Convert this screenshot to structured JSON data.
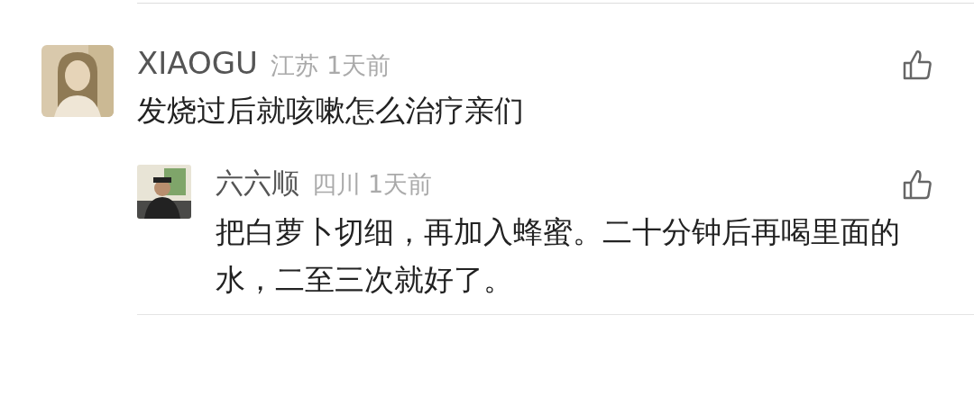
{
  "comments": [
    {
      "name": "XIAOGU",
      "location": "江苏",
      "time": "1天前",
      "text": "发烧过后就咳嗽怎么治疗亲们",
      "replies": [
        {
          "name": "六六顺",
          "location": "四川",
          "time": "1天前",
          "text": "把白萝卜切细，再加入蜂蜜。二十分钟后再喝里面的水，二至三次就好了。"
        }
      ]
    }
  ]
}
